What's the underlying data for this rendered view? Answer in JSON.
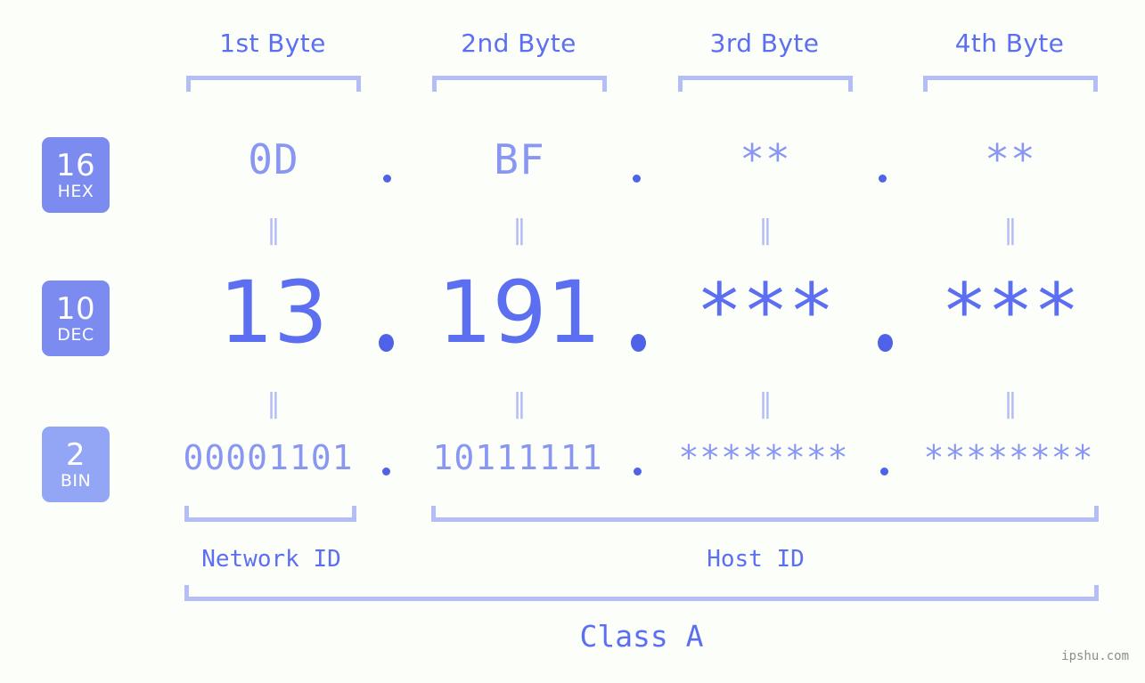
{
  "watermark": "ipshu.com",
  "colors": {
    "background": "#fcfefa",
    "accent": "#5b6ff0",
    "accent_light": "#8a97f2",
    "bracket": "#b5bdf7",
    "badge_strong": "#7b8bef",
    "badge_light": "#93a6f5",
    "dot": "#4f63e8",
    "watermark_text": "#8d8d8d"
  },
  "byte_headers": [
    {
      "label": "1st Byte"
    },
    {
      "label": "2nd Byte"
    },
    {
      "label": "3rd Byte"
    },
    {
      "label": "4th Byte"
    }
  ],
  "bases": [
    {
      "num": "16",
      "name": "HEX"
    },
    {
      "num": "10",
      "name": "DEC"
    },
    {
      "num": "2",
      "name": "BIN"
    }
  ],
  "rows": {
    "hex": {
      "values": [
        "0D",
        "BF",
        "**",
        "**"
      ]
    },
    "dec": {
      "values": [
        "13",
        "191",
        "***",
        "***"
      ]
    },
    "bin": {
      "values": [
        "00001101",
        "10111111",
        "********",
        "********"
      ]
    }
  },
  "separators": {
    "hex": [
      ".",
      ".",
      "."
    ],
    "dec": [
      ".",
      ".",
      "."
    ],
    "bin": [
      ".",
      ".",
      "."
    ]
  },
  "equals": {
    "symbol": "‖",
    "hex_to_dec": [
      "‖",
      "‖",
      "‖",
      "‖"
    ],
    "dec_to_bin": [
      "‖",
      "‖",
      "‖",
      "‖"
    ]
  },
  "id_sections": [
    {
      "label": "Network ID"
    },
    {
      "label": "Host ID"
    }
  ],
  "class": {
    "label": "Class A"
  }
}
